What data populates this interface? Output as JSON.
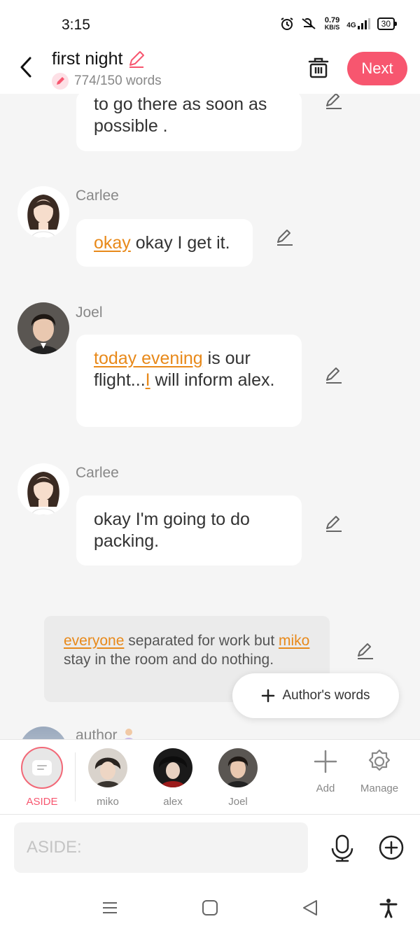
{
  "status_bar": {
    "time": "3:15",
    "speed_value": "0.79",
    "speed_unit": "KB/S",
    "network": "4G",
    "battery": "30"
  },
  "header": {
    "title": "first night",
    "word_count": "774/150 words",
    "next_label": "Next"
  },
  "chat": {
    "top_message": "to go there as soon as possible .",
    "messages": [
      {
        "speaker": "Carlee",
        "highlight": "okay",
        "text": " okay I get it."
      },
      {
        "speaker": "Joel",
        "highlight": "today evening",
        "text_a": " is our flight...",
        "highlight2": "I",
        "text_b": " will inform alex."
      },
      {
        "speaker": "Carlee",
        "text": "okay I'm going to do packing."
      }
    ],
    "narration": {
      "hl1": "everyone",
      "text1": " separated for work but ",
      "hl2": "miko",
      "text2": " stay in the room and do nothing."
    },
    "authors_words_label": "Author's words",
    "author_peek": "author"
  },
  "characters": {
    "items": [
      {
        "name": "ASIDE"
      },
      {
        "name": "miko"
      },
      {
        "name": "alex"
      },
      {
        "name": "Joel"
      }
    ],
    "add_label": "Add",
    "manage_label": "Manage"
  },
  "input": {
    "placeholder": "ASIDE:"
  },
  "colors": {
    "accent": "#f7566f",
    "highlight": "#e8891a"
  }
}
